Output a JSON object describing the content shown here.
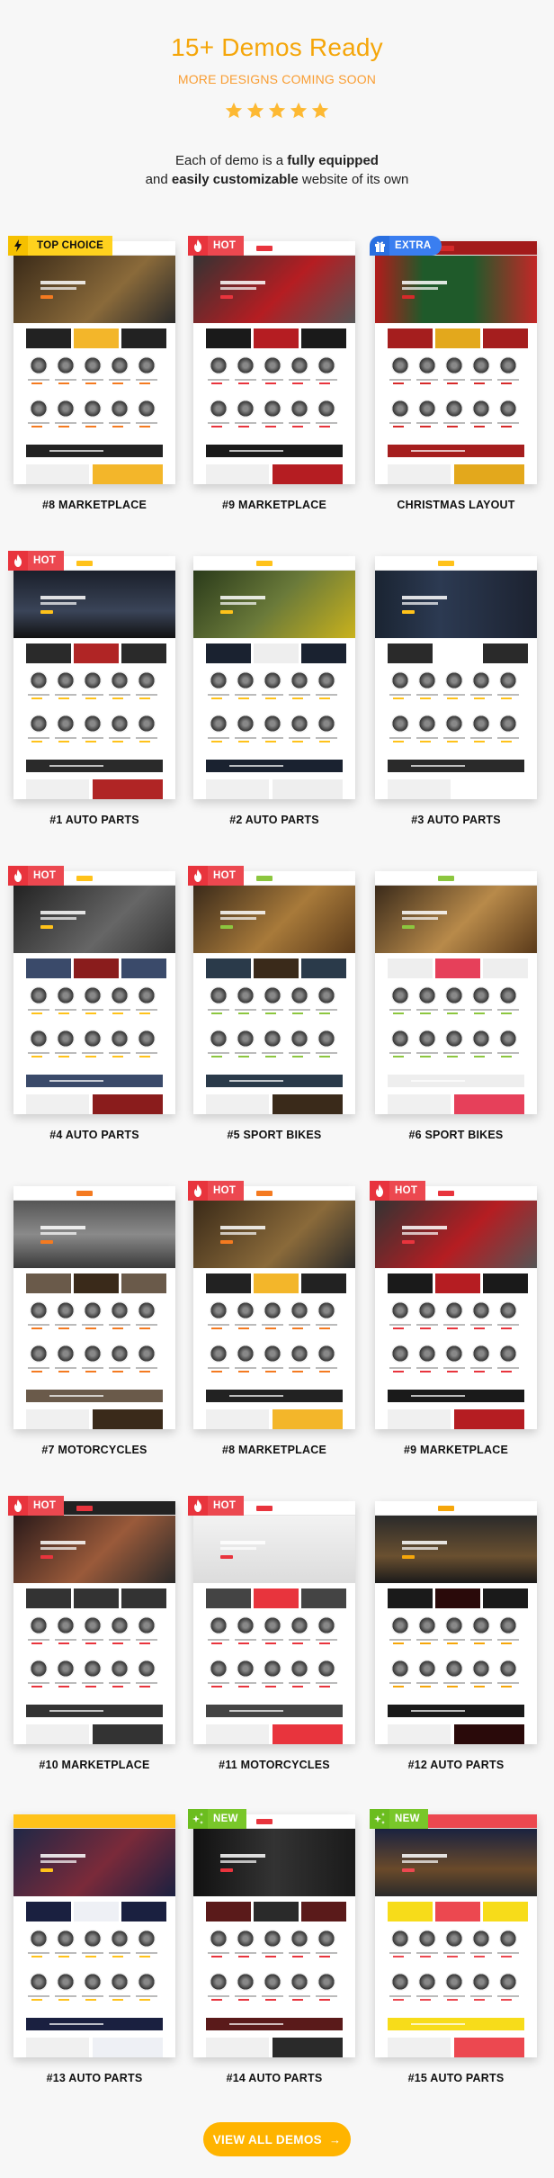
{
  "header": {
    "title": "15+ Demos Ready",
    "subtitle": "MORE DESIGNS COMING SOON",
    "rating": 5,
    "rating_max": 5,
    "desc_line1_pre": "Each of demo is a ",
    "desc_line1_bold": "fully equipped",
    "desc_line2_pre": "and ",
    "desc_line2_bold": "easily customizable",
    "desc_line2_post": " website of its own"
  },
  "colors": {
    "accent": "#f5a60a",
    "subtitle": "#f99d32",
    "hot": "#ec4850",
    "new": "#79c72a",
    "top_choice": "#ffd21e",
    "extra": "#3a7ef0",
    "button": "#ffb400"
  },
  "demos": [
    {
      "label": "#8 MARKETPLACE",
      "badge": "TOP CHOICE",
      "badge_icon": "lightning-icon",
      "theme": "dark-orange"
    },
    {
      "label": "#9 MARKETPLACE",
      "badge": "HOT",
      "badge_icon": "flame-icon",
      "theme": "red"
    },
    {
      "label": "CHRISTMAS LAYOUT",
      "badge": "EXTRA",
      "badge_icon": "gift-icon",
      "theme": "christmas"
    },
    {
      "label": "#1 AUTO PARTS",
      "badge": "HOT",
      "badge_icon": "flame-icon",
      "theme": "dark-yellow"
    },
    {
      "label": "#2 AUTO PARTS",
      "badge": "",
      "badge_icon": "",
      "theme": "yellow"
    },
    {
      "label": "#3 AUTO PARTS",
      "badge": "",
      "badge_icon": "",
      "theme": "dark-blue"
    },
    {
      "label": "#4 AUTO PARTS",
      "badge": "HOT",
      "badge_icon": "flame-icon",
      "theme": "mono"
    },
    {
      "label": "#5 SPORT BIKES",
      "badge": "HOT",
      "badge_icon": "flame-icon",
      "theme": "bike"
    },
    {
      "label": "#6 SPORT BIKES",
      "badge": "",
      "badge_icon": "",
      "theme": "bike-green"
    },
    {
      "label": "#7 MOTORCYCLES",
      "badge": "",
      "badge_icon": "",
      "theme": "moto"
    },
    {
      "label": "#8 MARKETPLACE",
      "badge": "HOT",
      "badge_icon": "flame-icon",
      "theme": "dark-orange"
    },
    {
      "label": "#9 MARKETPLACE",
      "badge": "HOT",
      "badge_icon": "flame-icon",
      "theme": "red"
    },
    {
      "label": "#10 MARKETPLACE",
      "badge": "HOT",
      "badge_icon": "flame-icon",
      "theme": "red-side"
    },
    {
      "label": "#11 MOTORCYCLES",
      "badge": "HOT",
      "badge_icon": "flame-icon",
      "theme": "moto-red"
    },
    {
      "label": "#12 AUTO PARTS",
      "badge": "",
      "badge_icon": "",
      "theme": "dark-orange2"
    },
    {
      "label": "#13 AUTO PARTS",
      "badge": "",
      "badge_icon": "",
      "theme": "navy-yellow"
    },
    {
      "label": "#14 AUTO PARTS",
      "badge": "NEW",
      "badge_icon": "sparkle-icon",
      "theme": "black-red"
    },
    {
      "label": "#15 AUTO PARTS",
      "badge": "NEW",
      "badge_icon": "sparkle-icon",
      "theme": "red-yellow"
    }
  ],
  "cta": {
    "label": "VIEW ALL DEMOS",
    "arrow": "→"
  }
}
